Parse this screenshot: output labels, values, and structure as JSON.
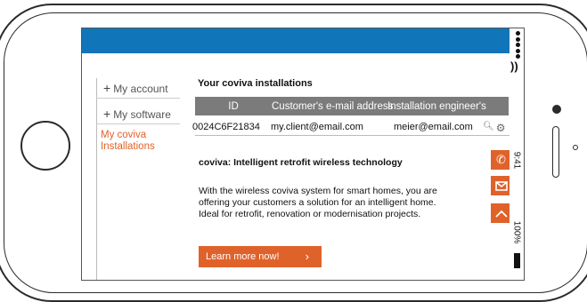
{
  "status": {
    "time": "9:41",
    "battery": "100%"
  },
  "nav": {
    "items": [
      {
        "label": "My account"
      },
      {
        "label": "My software"
      }
    ],
    "active": {
      "line1": "My coviva",
      "line2": "Installations"
    }
  },
  "main": {
    "title": "Your coviva installations",
    "table": {
      "headers": [
        "ID",
        "Customer's e-mail address",
        "Installation engineer's"
      ],
      "rows": [
        {
          "id": "0024C6F21834",
          "customer_email": "my.client@email.com",
          "engineer_email": "meier@email.com"
        }
      ]
    },
    "heading": "coviva: Intelligent retrofit wireless technology",
    "paragraph": "With the wireless coviva system for smart homes, you are offering your customers a solution for an intelligent home. Ideal for retrofit, renovation or modernisation projects.",
    "cta_label": "Learn more now!"
  },
  "colors": {
    "accent": "#e0622b",
    "header_blue": "#1175b9",
    "table_header": "#7b7b7b"
  },
  "icons": [
    "phone-icon",
    "mail-icon",
    "chevron-up-icon",
    "search-icon",
    "gear-icon",
    "wifi-icon",
    "battery-icon"
  ]
}
